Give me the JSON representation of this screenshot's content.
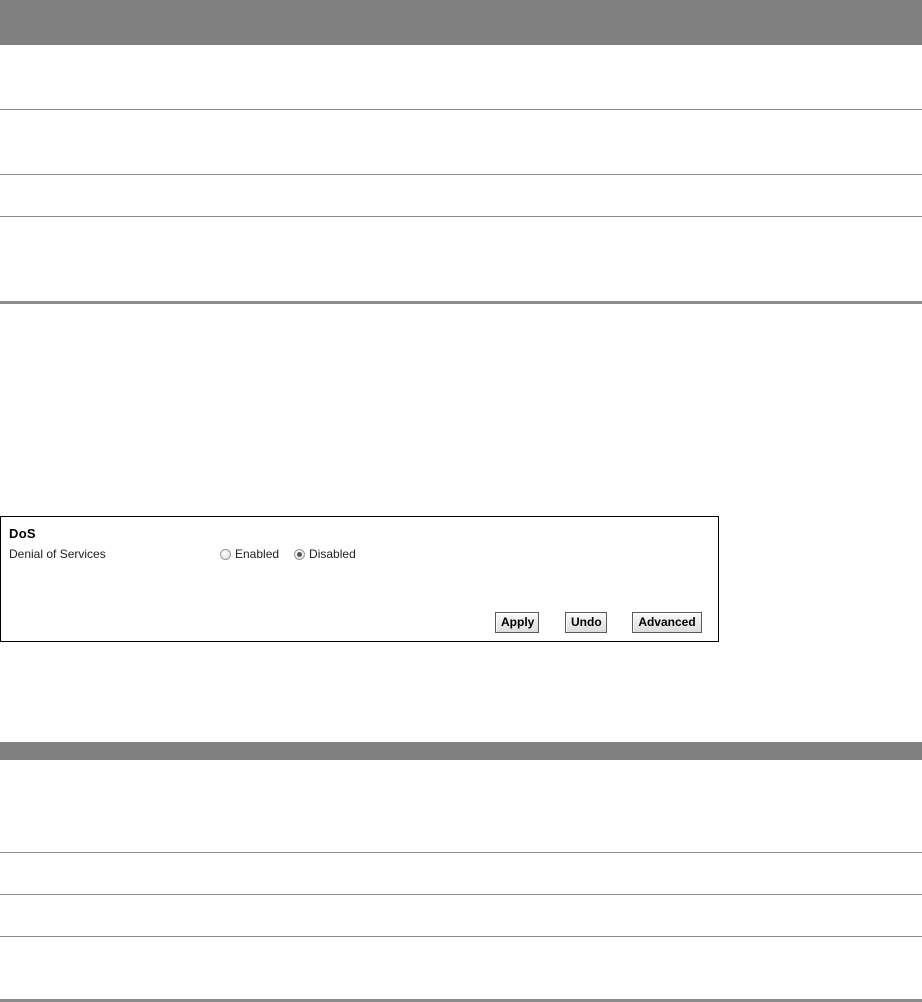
{
  "panel": {
    "title": "DoS",
    "field_label": "Denial of Services",
    "options": [
      {
        "label": "Enabled",
        "checked": false
      },
      {
        "label": "Disabled",
        "checked": true
      }
    ],
    "buttons": {
      "apply": "Apply",
      "undo": "Undo",
      "advanced": "Advanced"
    }
  },
  "colors": {
    "table_header": "#808080",
    "rule": "#8c8c8c",
    "panel_border": "#000000"
  }
}
